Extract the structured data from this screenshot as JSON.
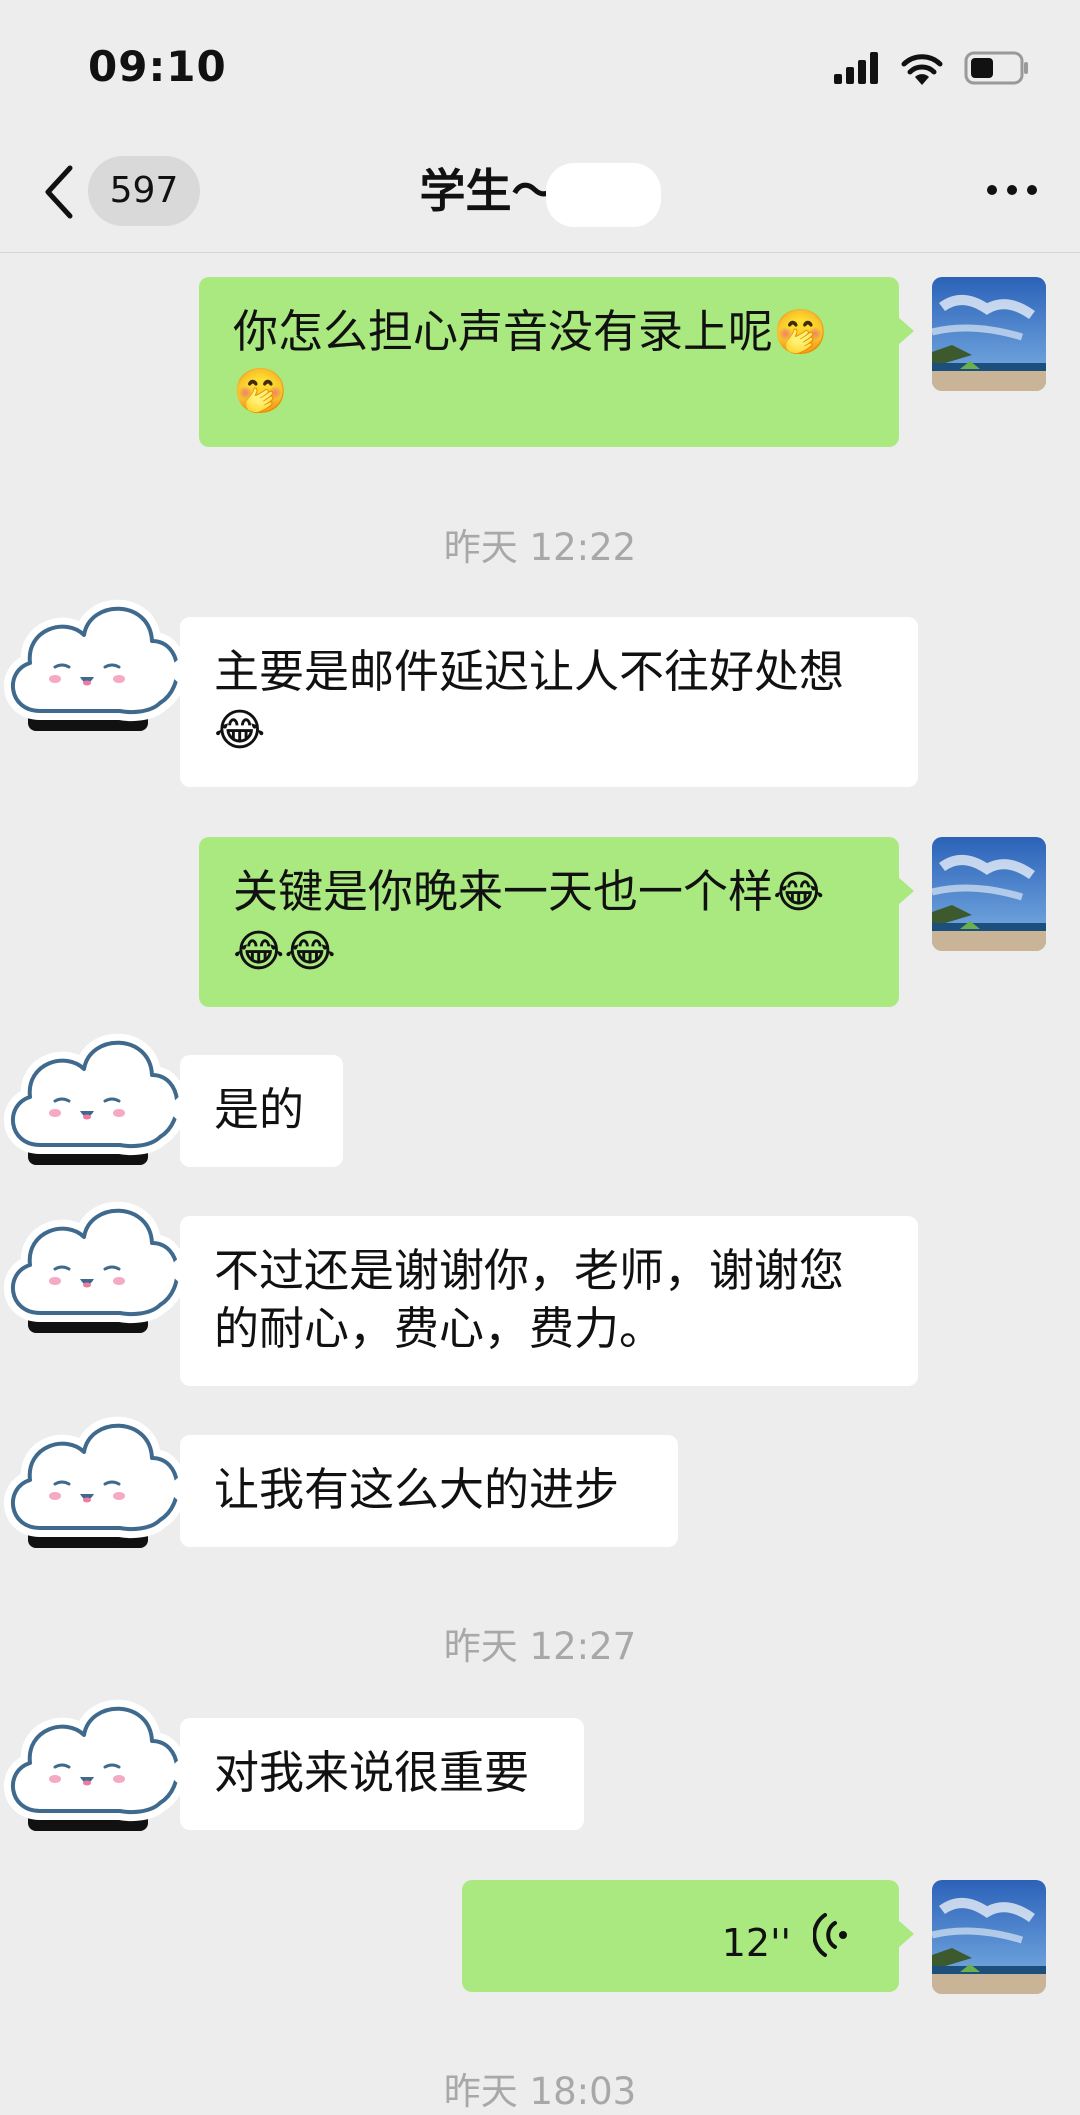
{
  "status_bar": {
    "time": "09:10"
  },
  "header": {
    "back_label": "<",
    "unread_count": "597",
    "contact_name": "学生～"
  },
  "messages": [
    {
      "side": "right",
      "text": "你怎么担心声音没有录上呢",
      "emoji": "🤭🤭"
    },
    {
      "timestamp": "昨天 12:22"
    },
    {
      "side": "left",
      "text": "主要是邮件延迟让人不往好处想",
      "emoji": "😂"
    },
    {
      "side": "right",
      "text": "关键是你晚来一天也一个样",
      "emoji": "😂😂😂"
    },
    {
      "side": "left",
      "text": "是的"
    },
    {
      "side": "left",
      "text": "不过还是谢谢你，老师，谢谢您的耐心，费心，费力。"
    },
    {
      "side": "left",
      "text": "让我有这么大的进步"
    },
    {
      "timestamp": "昨天 12:27"
    },
    {
      "side": "left",
      "text": "对我来说很重要"
    },
    {
      "side": "right",
      "type": "voice",
      "duration": "12''"
    },
    {
      "timestamp": "昨天 18:03"
    }
  ],
  "colors": {
    "sent_bubble": "#a9e97f",
    "received_bubble": "#ffffff",
    "background": "#ededed"
  }
}
